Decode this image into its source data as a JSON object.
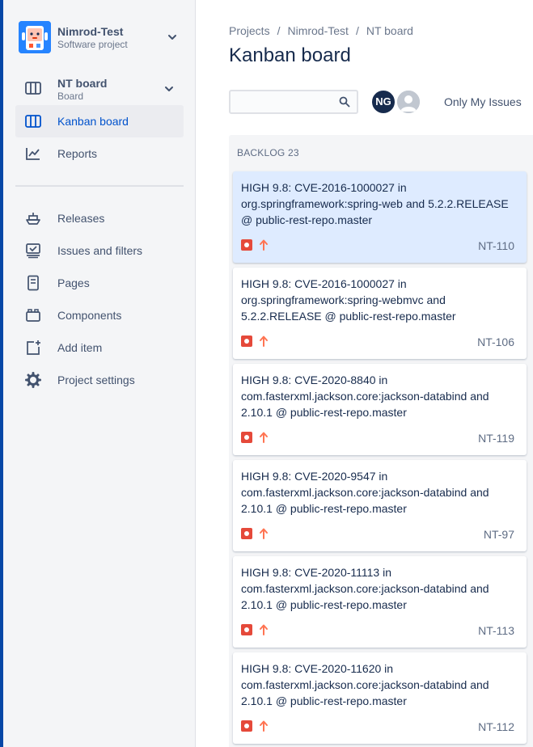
{
  "project": {
    "name": "Nimrod-Test",
    "type": "Software project"
  },
  "board_menu": {
    "name": "NT board",
    "sub": "Board"
  },
  "nav": {
    "kanban": "Kanban board",
    "reports": "Reports",
    "releases": "Releases",
    "issues": "Issues and filters",
    "pages": "Pages",
    "components": "Components",
    "add_item": "Add item",
    "settings": "Project settings"
  },
  "breadcrumb": [
    "Projects",
    "Nimrod-Test",
    "NT board"
  ],
  "breadcrumb_sep": "/",
  "page_title": "Kanban board",
  "search": {
    "value": "",
    "placeholder": ""
  },
  "avatars": {
    "user_initials": "NG"
  },
  "filters": {
    "only_my_issues": "Only My Issues"
  },
  "column": {
    "name": "BACKLOG",
    "count": "23"
  },
  "cards": [
    {
      "text": "HIGH 9.8: CVE-2016-1000027 in org.springframework:spring-web and 5.2.2.RELEASE @ public-rest-repo.master",
      "key": "NT-110"
    },
    {
      "text": "HIGH 9.8: CVE-2016-1000027 in org.springframework:spring-webmvc and 5.2.2.RELEASE @ public-rest-repo.master",
      "key": "NT-106"
    },
    {
      "text": "HIGH 9.8: CVE-2020-8840 in com.fasterxml.jackson.core:jackson-databind and 2.10.1 @ public-rest-repo.master",
      "key": "NT-119"
    },
    {
      "text": "HIGH 9.8: CVE-2020-9547 in com.fasterxml.jackson.core:jackson-databind and 2.10.1 @ public-rest-repo.master",
      "key": "NT-97"
    },
    {
      "text": "HIGH 9.8: CVE-2020-11113 in com.fasterxml.jackson.core:jackson-databind and 2.10.1 @ public-rest-repo.master",
      "key": "NT-113"
    },
    {
      "text": "HIGH 9.8: CVE-2020-11620 in com.fasterxml.jackson.core:jackson-databind and 2.10.1 @ public-rest-repo.master",
      "key": "NT-112"
    }
  ],
  "colors": {
    "accent": "#0052cc",
    "sidebar_bg": "#f4f5f7",
    "selected_card": "#deebff",
    "bug_red": "#e5493a",
    "priority_orange": "#ff7452"
  },
  "icons": {
    "type": "bug-icon",
    "priority": "priority-high-arrow-icon"
  }
}
